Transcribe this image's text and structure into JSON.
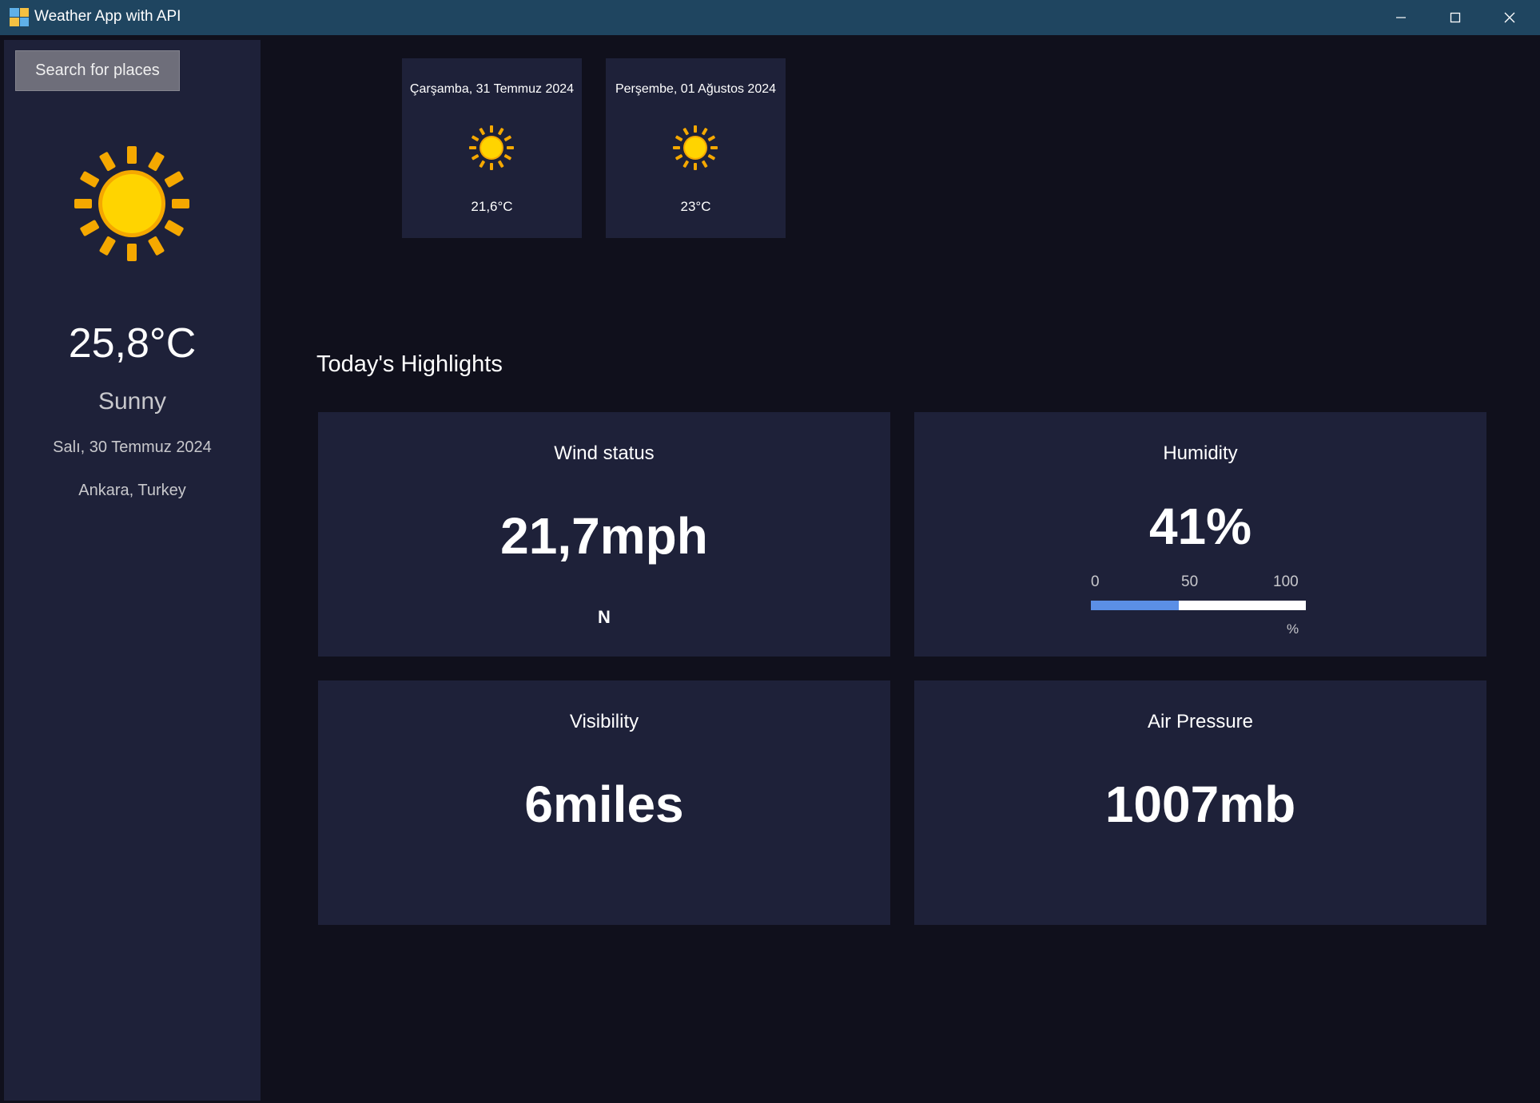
{
  "window": {
    "title": "Weather App with API",
    "icon": "app-icon"
  },
  "sidebar": {
    "search_label": "Search for places",
    "weather_icon": "sun-icon",
    "temperature": "25,8°C",
    "condition": "Sunny",
    "date": "Salı, 30 Temmuz 2024",
    "location": "Ankara, Turkey"
  },
  "forecast": [
    {
      "date": "Çarşamba, 31 Temmuz 2024",
      "icon": "sun-icon",
      "temp": "21,6°C"
    },
    {
      "date": "Perşembe, 01 Ağustos 2024",
      "icon": "sun-icon",
      "temp": "23°C"
    }
  ],
  "highlights": {
    "title": "Today's Highlights",
    "wind": {
      "label": "Wind status",
      "value": "21,7mph",
      "direction": "N"
    },
    "humidity": {
      "label": "Humidity",
      "value": "41%",
      "percent": 41,
      "ticks": [
        "0",
        "50",
        "100"
      ],
      "unit": "%"
    },
    "visibility": {
      "label": "Visibility",
      "value": "6miles"
    },
    "pressure": {
      "label": "Air Pressure",
      "value": "1007mb"
    }
  },
  "colors": {
    "background": "#10101c",
    "card": "#1e2139",
    "titlebar": "#1f4560",
    "sun_core": "#ffd400",
    "sun_rays": "#f5a800",
    "humidity_fill": "#5b8fe6"
  }
}
